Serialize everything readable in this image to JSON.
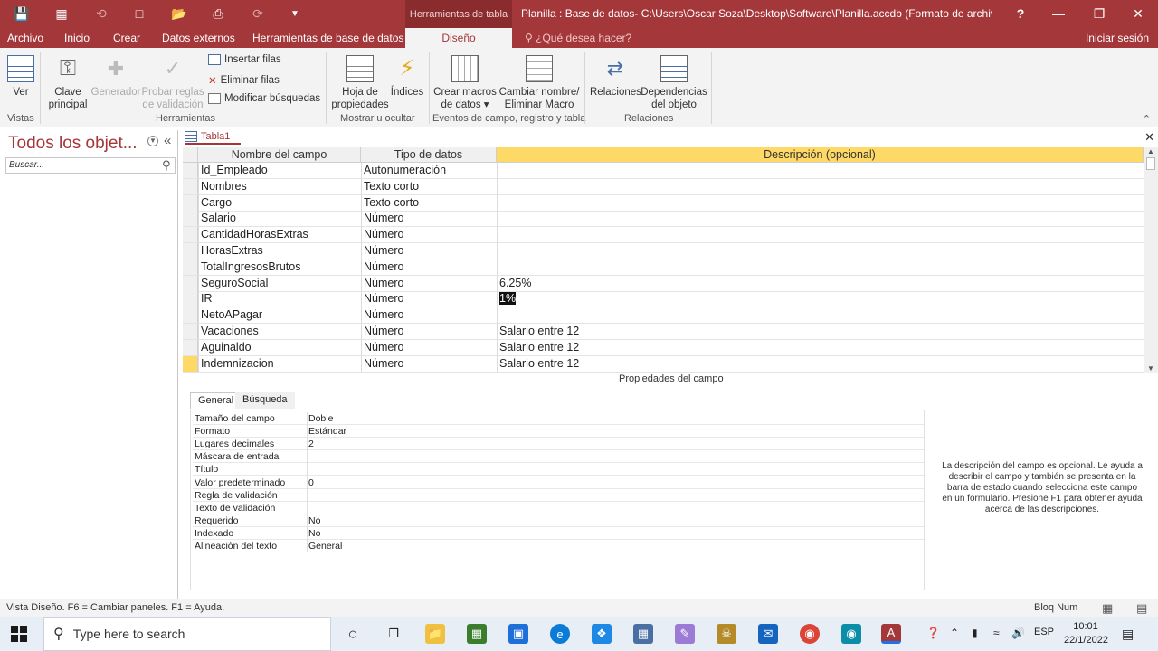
{
  "titlebar": {
    "context_tab": "Herramientas de tabla",
    "title": "Planilla : Base de datos- C:\\Users\\Oscar Soza\\Desktop\\Software\\Planilla.accdb (Formato de archivo Acc...",
    "help": "?"
  },
  "tabs": [
    "Archivo",
    "Inicio",
    "Crear",
    "Datos externos",
    "Herramientas de base de datos"
  ],
  "active_tab": "Diseño",
  "tell_me": "¿Qué desea hacer?",
  "sign_in": "Iniciar sesión",
  "ribbon": {
    "ver": "Ver",
    "clave": [
      "Clave",
      "principal"
    ],
    "generador": "Generador",
    "probar": [
      "Probar reglas",
      "de validación"
    ],
    "insertar": "Insertar filas",
    "eliminar": "Eliminar filas",
    "modificar": "Modificar búsquedas",
    "hoja": [
      "Hoja de",
      "propiedades"
    ],
    "indices": "Índices",
    "macros": [
      "Crear macros",
      "de datos"
    ],
    "cambiar": [
      "Cambiar nombre/",
      "Eliminar Macro"
    ],
    "relaciones": "Relaciones",
    "dependencias": [
      "Dependencias",
      "del objeto"
    ],
    "groups": [
      "Vistas",
      "Herramientas",
      "Mostrar u ocultar",
      "Eventos de campo, registro y tabla",
      "Relaciones"
    ]
  },
  "nav": {
    "title": "Todos los objet...",
    "search_placeholder": "Buscar..."
  },
  "doc_tab": "Tabla1",
  "grid": {
    "headers": [
      "Nombre del campo",
      "Tipo de datos",
      "Descripción (opcional)"
    ],
    "rows": [
      {
        "name": "Id_Empleado",
        "type": "Autonumeración",
        "desc": ""
      },
      {
        "name": "Nombres",
        "type": "Texto corto",
        "desc": ""
      },
      {
        "name": "Cargo",
        "type": "Texto corto",
        "desc": ""
      },
      {
        "name": "Salario",
        "type": "Número",
        "desc": ""
      },
      {
        "name": "CantidadHorasExtras",
        "type": "Número",
        "desc": ""
      },
      {
        "name": "HorasExtras",
        "type": "Número",
        "desc": ""
      },
      {
        "name": "TotalIngresosBrutos",
        "type": "Número",
        "desc": ""
      },
      {
        "name": "SeguroSocial",
        "type": "Número",
        "desc": "6.25%"
      },
      {
        "name": "IR",
        "type": "Número",
        "desc": "1%"
      },
      {
        "name": "NetoAPagar",
        "type": "Número",
        "desc": ""
      },
      {
        "name": "Vacaciones",
        "type": "Número",
        "desc": "Salario entre 12"
      },
      {
        "name": "Aguinaldo",
        "type": "Número",
        "desc": "Salario entre 12"
      },
      {
        "name": "Indemnizacion",
        "type": "Número",
        "desc": "Salario entre 12"
      }
    ]
  },
  "field_props": {
    "title": "Propiedades del campo",
    "tabs": [
      "General",
      "Búsqueda"
    ],
    "rows": [
      {
        "k": "Tamaño del campo",
        "v": "Doble"
      },
      {
        "k": "Formato",
        "v": "Estándar"
      },
      {
        "k": "Lugares decimales",
        "v": "2"
      },
      {
        "k": "Máscara de entrada",
        "v": ""
      },
      {
        "k": "Título",
        "v": ""
      },
      {
        "k": "Valor predeterminado",
        "v": "0"
      },
      {
        "k": "Regla de validación",
        "v": ""
      },
      {
        "k": "Texto de validación",
        "v": ""
      },
      {
        "k": "Requerido",
        "v": "No"
      },
      {
        "k": "Indexado",
        "v": "No"
      },
      {
        "k": "Alineación del texto",
        "v": "General"
      }
    ],
    "help": "La descripción del campo es opcional. Le ayuda a describir el campo y también se presenta en la barra de estado cuando selecciona este campo en un formulario. Presione F1 para obtener ayuda acerca de las descripciones."
  },
  "status": {
    "left": "Vista Diseño.  F6 = Cambiar paneles.  F1 = Ayuda.",
    "right": "Bloq Num"
  },
  "taskbar": {
    "search": "Type here to search",
    "lang": "ESP",
    "time": "10:01",
    "date": "22/1/2022"
  },
  "colors": {
    "accent": "#a4373a",
    "header_highlight": "#ffd966",
    "selector_highlight": "#ffd966"
  }
}
